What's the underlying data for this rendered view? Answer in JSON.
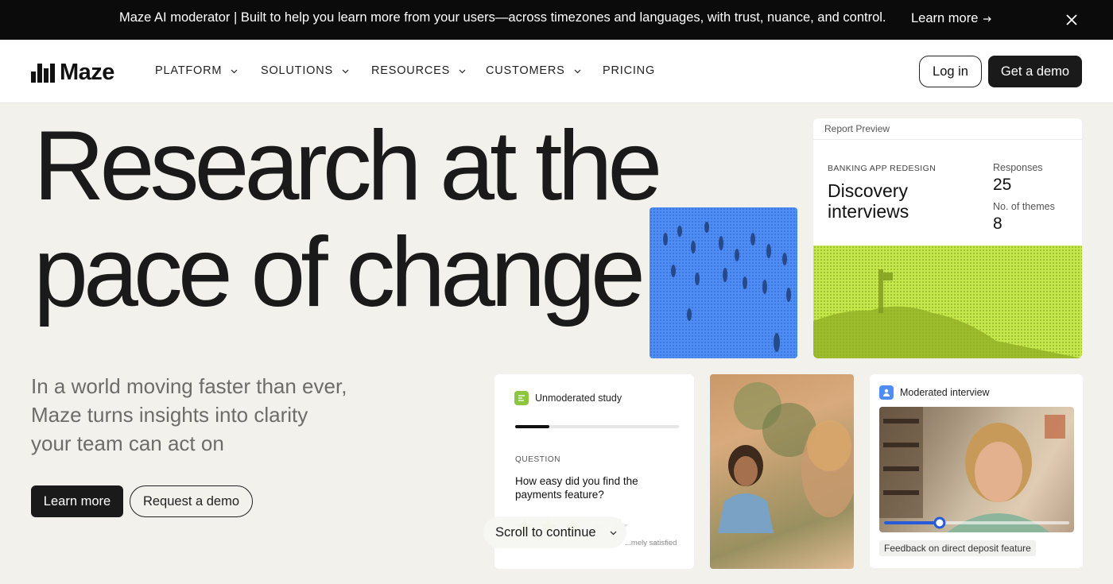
{
  "announcement": {
    "message": "Maze AI moderator | Built to help you learn more from your users—across timezones and languages, with trust, nuance, and control.",
    "link_label": "Learn more"
  },
  "nav": {
    "logo_text": "Maze",
    "items": [
      {
        "label": "PLATFORM",
        "has_dropdown": true
      },
      {
        "label": "SOLUTIONS",
        "has_dropdown": true
      },
      {
        "label": "RESOURCES",
        "has_dropdown": true
      },
      {
        "label": "CUSTOMERS",
        "has_dropdown": true
      },
      {
        "label": "PRICING",
        "has_dropdown": false
      }
    ],
    "login_label": "Log in",
    "demo_label": "Get a demo"
  },
  "hero": {
    "headline_line1": "Research at the",
    "headline_line2": "pace of change",
    "sub_line1": "In a world moving faster than ever,",
    "sub_line2": "Maze turns insights into clarity",
    "sub_line3": "your team can act on",
    "primary_label": "Learn more",
    "secondary_label": "Request a demo"
  },
  "report_preview": {
    "header": "Report Preview",
    "eyebrow": "BANKING APP REDESIGN",
    "title_line1": "Discovery",
    "title_line2": "interviews",
    "responses_label": "Responses",
    "responses_value": "25",
    "themes_label": "No. of themes",
    "themes_value": "8"
  },
  "unmoderated_study": {
    "title": "Unmoderated study",
    "progress": 0.21,
    "question_label": "QUESTION",
    "question_text": "How easy did you find the payments feature?",
    "rating_filled": 3,
    "rating_total": 5,
    "scale_label": "...mely satisfied"
  },
  "scroll": {
    "label": "Scroll to continue"
  },
  "moderated_interview": {
    "title": "Moderated interview",
    "caption": "Feedback on direct deposit feature",
    "playback_progress": 0.3
  },
  "colors": {
    "background": "#f2f1ec",
    "dark": "#1a1a1a",
    "blue": "#4f8df5",
    "lime": "#c5e84c",
    "study_green": "#8cc63f"
  }
}
